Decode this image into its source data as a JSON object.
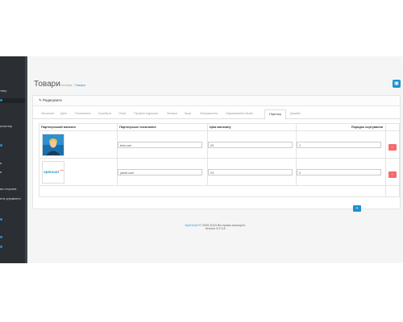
{
  "sidebar": {
    "items": [
      {
        "label": "тану"
      },
      {
        "label": ""
      },
      {
        "label": "ксоплер"
      },
      {
        "label": ""
      },
      {
        "label": "и"
      },
      {
        "label": "и"
      },
      {
        "label": "ия сторона"
      },
      {
        "label": "ита управлінн"
      },
      {
        "label": ""
      },
      {
        "label": ""
      },
      {
        "label": ""
      }
    ]
  },
  "header": {
    "title": "Товари",
    "breadcrumb_home": "Головна",
    "breadcrumb_current": "Товари"
  },
  "panel": {
    "title": "Редагувати",
    "tabs": [
      "Загальне",
      "Дані",
      "Посилання",
      "Атрибути",
      "Опції",
      "Профілі підписки",
      "Знижки",
      "Акції",
      "Зображення",
      "Нарахування балів",
      "Партнер",
      "Дизайн"
    ],
    "active_tab": "Партнер"
  },
  "table": {
    "headers": [
      "Партнерський магазин",
      "Партнерське посилання",
      "Ціна магазину",
      "Порядок сортування"
    ],
    "rows": [
      {
        "link": "test.com",
        "price": "20",
        "sort": "1"
      },
      {
        "link": "yandi.com",
        "price": "24",
        "sort": "2"
      }
    ]
  },
  "logo_text": "opencart",
  "footer": {
    "brand": "OpenCart",
    "copyright": " © 2009-2024 Всі права захищені.",
    "version": "Version 3.0.3.8"
  },
  "icons": {
    "save": "save-icon",
    "delete": "minus-circle-icon",
    "add": "plus-circle-icon",
    "edit": "pencil-icon"
  },
  "colors": {
    "primary": "#1e91cf",
    "danger": "#f56b6b",
    "sidebar": "#2b2e33"
  }
}
